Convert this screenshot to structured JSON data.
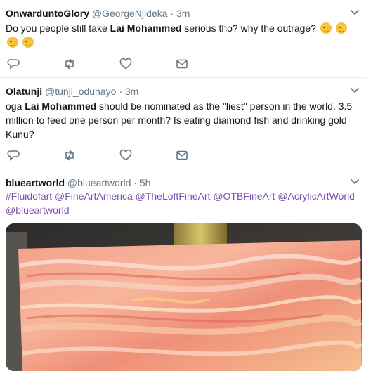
{
  "tweets": [
    {
      "name": "OnwarduntoGlory",
      "handle": "@GeorgeNjideka",
      "sep": "·",
      "time": "3m",
      "text_a": "Do you people still take ",
      "text_b": "Lai Mohammed",
      "text_c": " serious tho? why the outrage?"
    },
    {
      "name": "Olatunji",
      "handle": "@tunji_odunayo",
      "sep": "·",
      "time": "3m",
      "text_a": "oga ",
      "text_b": "Lai Mohammed",
      "text_c": " should be nominated as the \"liest\" person in the world. 3.5 million to feed one person per month? Is eating diamond fish and drinking gold Kunu?"
    },
    {
      "name": "blueartworld",
      "handle": "@blueartworld",
      "sep": "·",
      "time": "5h",
      "tags": [
        "#Fluidofart",
        "@FineArtAmerica",
        "@TheLoftFineArt",
        "@OTBFineArt",
        "@AcrylicArtWorld",
        "@blueartworld"
      ]
    }
  ],
  "icons": {
    "reply": "reply-icon",
    "retweet": "retweet-icon",
    "like": "heart-icon",
    "dm": "envelope-icon",
    "menu": "chevron-down-icon",
    "emoji": "winking-face-emoji"
  },
  "colors": {
    "link": "#7b4fb0",
    "icon": "#657786",
    "divider": "#e6ecf0"
  }
}
